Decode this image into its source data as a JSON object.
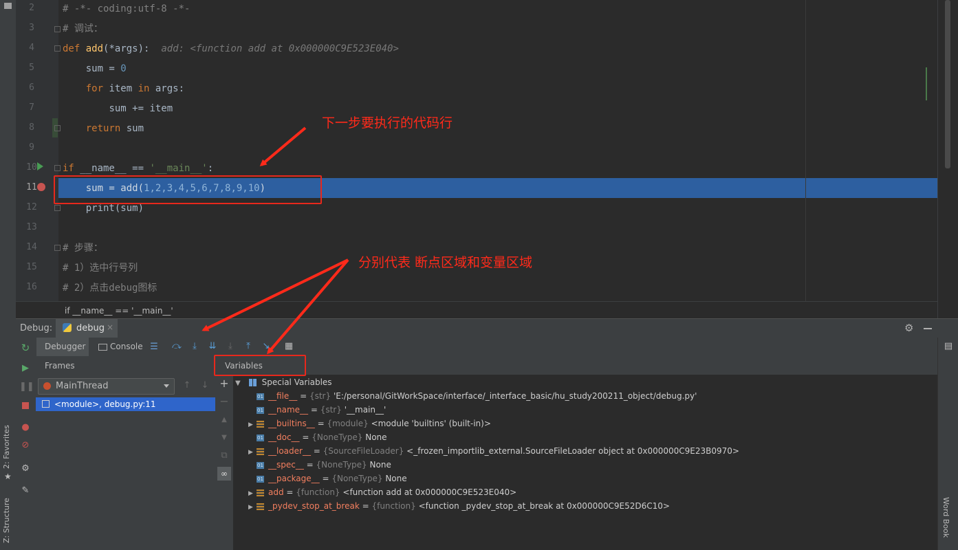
{
  "left_strip": {
    "favorites_label": "2: Favorites",
    "structure_label": "Z: Structure"
  },
  "editor": {
    "lines": [
      {
        "no": "2"
      },
      {
        "no": "3"
      },
      {
        "no": "4"
      },
      {
        "no": "5"
      },
      {
        "no": "6"
      },
      {
        "no": "7"
      },
      {
        "no": "8"
      },
      {
        "no": "9"
      },
      {
        "no": "10"
      },
      {
        "no": "11"
      },
      {
        "no": "12"
      },
      {
        "no": "13"
      },
      {
        "no": "14"
      },
      {
        "no": "15"
      },
      {
        "no": "16"
      }
    ],
    "code": {
      "l2": "# -*- coding:utf-8 -*-",
      "l3": "# 调试：",
      "l4_kw": "def",
      "l4_fn": "add",
      "l4_rest": "(*args):",
      "l4_hint": "add: <function add at 0x000000C9E523E040>",
      "l5_a": "sum = ",
      "l5_num": "0",
      "l6_kw1": "for",
      "l6_mid": " item ",
      "l6_kw2": "in",
      "l6_rest": " args:",
      "l7": "sum += item",
      "l8_kw": "return",
      "l8_rest": " sum",
      "l10_kw": "if",
      "l10_mid": " __name__ == ",
      "l10_str": "'__main__'",
      "l10_end": ":",
      "l11_a": "sum = add(",
      "l11_args": "1,2,3,4,5,6,7,8,9,10",
      "l11_end": ")",
      "l12": "print(sum)",
      "l14": "# 步骤：",
      "l15": "# 1）选中行号列",
      "l16": "# 2）点击debug图标"
    },
    "breadcrumb": "if __name__ == '__main__'"
  },
  "debug": {
    "title": "Debug:",
    "tab": "debug",
    "tabs": {
      "debugger": "Debugger",
      "console": "Console"
    },
    "frames_label": "Frames",
    "thread": "MainThread",
    "frame_item": "<module>, debug.py:11",
    "variables_label": "Variables",
    "special_vars": "Special Variables",
    "variables": [
      {
        "name": "__file__",
        "type": "{str}",
        "value": "'E:/personal/GitWorkSpace/interface/_interface_basic/hu_study200211_object/debug.py'",
        "expandable": false,
        "kind": "01"
      },
      {
        "name": "__name__",
        "type": "{str}",
        "value": "'__main__'",
        "expandable": false,
        "kind": "01"
      },
      {
        "name": "__builtins__",
        "type": "{module}",
        "value": "<module 'builtins' (built-in)>",
        "expandable": true,
        "kind": "obj"
      },
      {
        "name": "__doc__",
        "type": "{NoneType}",
        "value": "None",
        "expandable": false,
        "kind": "01"
      },
      {
        "name": "__loader__",
        "type": "{SourceFileLoader}",
        "value": "<_frozen_importlib_external.SourceFileLoader object at 0x000000C9E23B0970>",
        "expandable": true,
        "kind": "obj"
      },
      {
        "name": "__spec__",
        "type": "{NoneType}",
        "value": "None",
        "expandable": false,
        "kind": "01"
      },
      {
        "name": "__package__",
        "type": "{NoneType}",
        "value": "None",
        "expandable": false,
        "kind": "01"
      },
      {
        "name": "add",
        "type": "{function}",
        "value": "<function add at 0x000000C9E523E040>",
        "expandable": true,
        "kind": "obj"
      },
      {
        "name": "_pydev_stop_at_break",
        "type": "{function}",
        "value": "<function _pydev_stop_at_break at 0x000000C9E52D6C10>",
        "expandable": true,
        "kind": "obj"
      }
    ],
    "word_book": "Word Book"
  },
  "annotations": {
    "next_line": "下一步要执行的代码行",
    "areas": "分别代表 断点区域和变量区域"
  },
  "colors": {
    "background": "#2b2b2b",
    "highlight": "#2d5fa0",
    "annotation": "#ff2a1a",
    "breakpoint": "#c75450"
  }
}
